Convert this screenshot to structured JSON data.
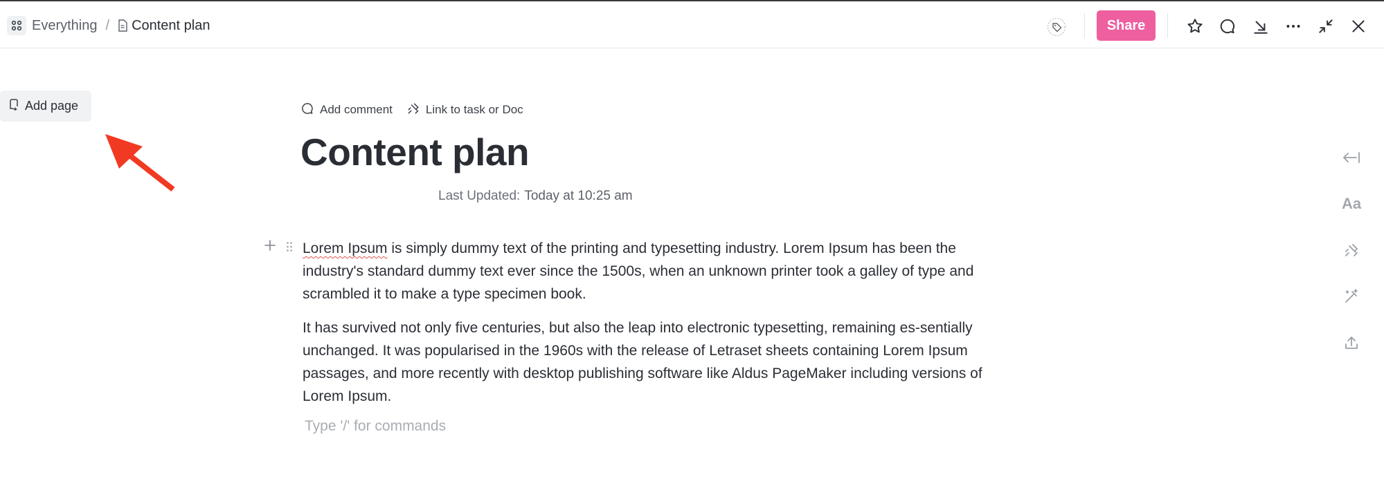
{
  "breadcrumb": {
    "workspace_label": "Everything",
    "separator": "/",
    "current_label": "Content plan"
  },
  "toolbar": {
    "share_label": "Share",
    "share_color": "#ee5fa0",
    "icons": [
      "tag-icon",
      "star-icon",
      "comment-icon",
      "download-icon",
      "more-icon",
      "collapse-icon",
      "close-icon"
    ]
  },
  "sidebar": {
    "add_page_label": "Add page"
  },
  "annotation": {
    "arrow_color": "#f23a22"
  },
  "doc": {
    "actions": {
      "add_comment_label": "Add comment",
      "link_task_label": "Link to task or Doc"
    },
    "title": "Content plan",
    "last_updated_label": "Last Updated:",
    "last_updated_value": "Today at 10:25 am",
    "para1_highlight": "Lorem Ipsum",
    "para1_rest": " is simply dummy text of the printing and typesetting industry. Lorem Ipsum has been the industry's standard dummy text ever since the 1500s, when an unknown printer took a galley of type and scrambled it to make a type specimen book.",
    "para2": "It has survived not only five centuries, but also the leap into electronic typesetting, remaining es-sentially unchanged. It was popularised in the 1960s with the release of Letraset sheets containing Lorem Ipsum passages, and more recently with desktop publishing software like Aldus PageMaker including versions of Lorem Ipsum.",
    "placeholder": "Type '/' for commands"
  },
  "right_rail": {
    "font_label": "Aa",
    "icons": [
      "collapse-left-icon",
      "font-icon",
      "link-icon",
      "magic-wand-icon",
      "export-icon"
    ]
  }
}
